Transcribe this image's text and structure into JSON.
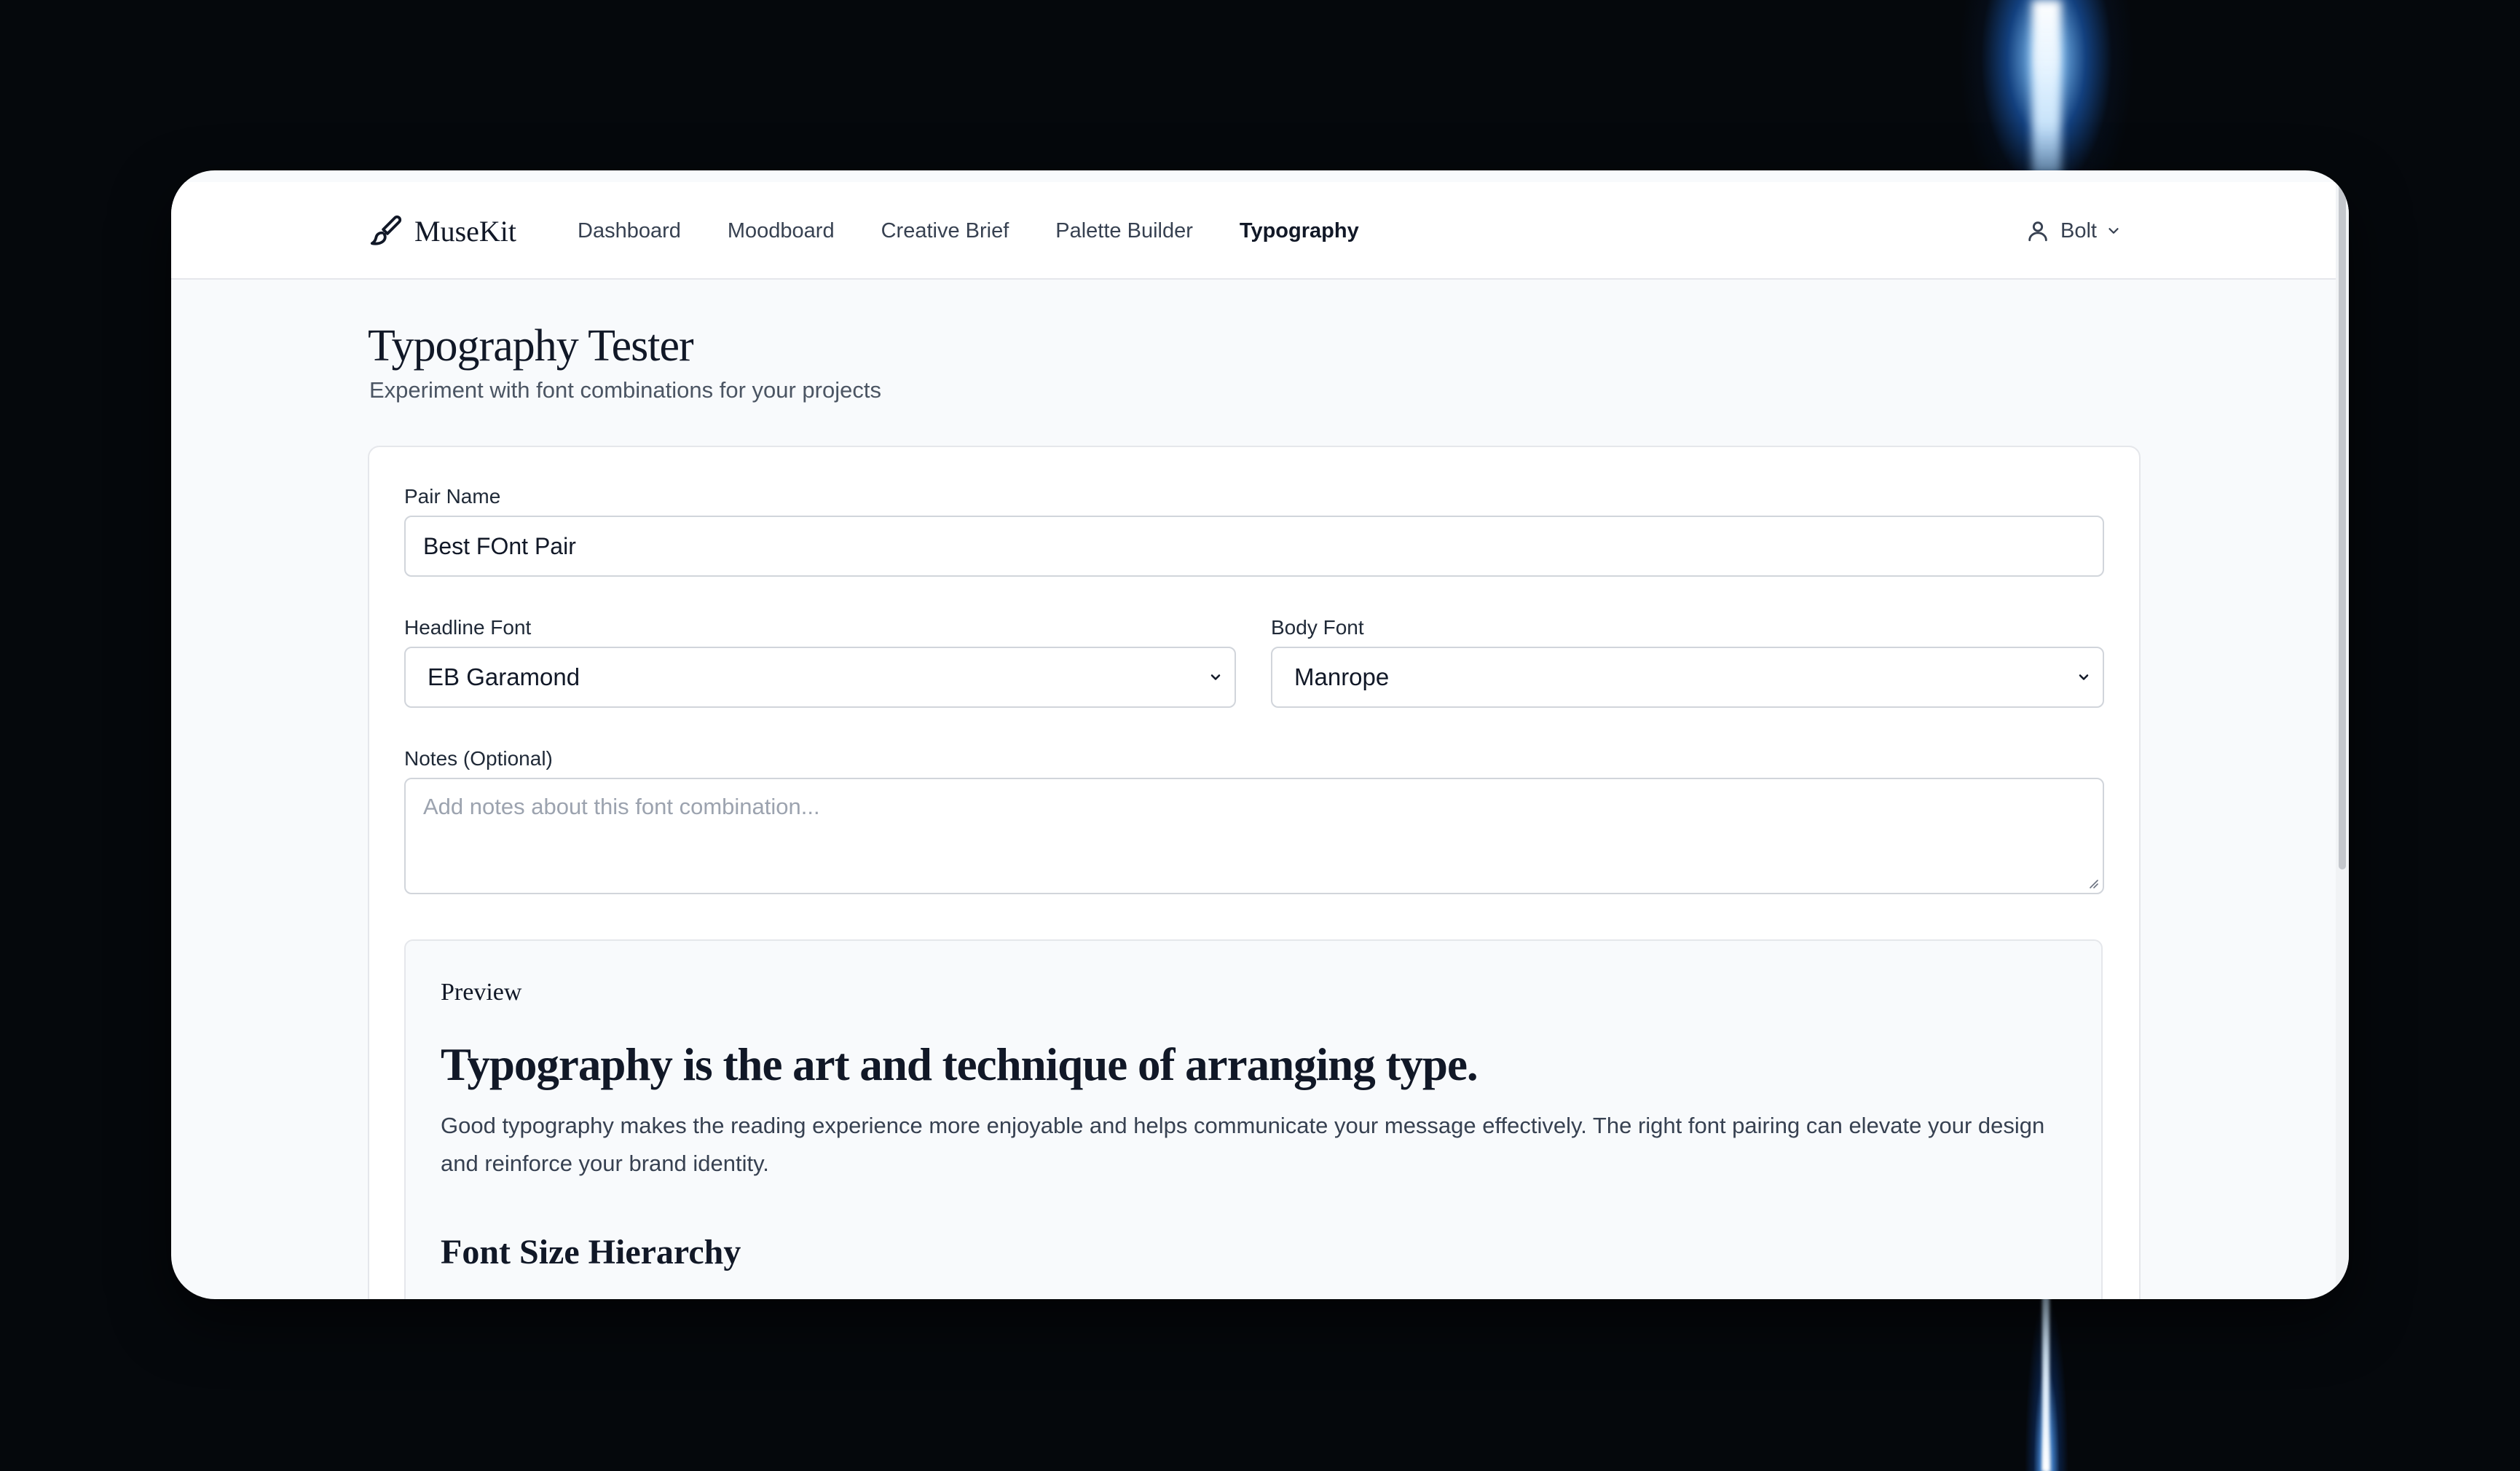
{
  "app": {
    "name": "MuseKit",
    "logo_icon": "paintbrush-icon"
  },
  "nav": {
    "items": [
      {
        "label": "Dashboard",
        "active": false
      },
      {
        "label": "Moodboard",
        "active": false
      },
      {
        "label": "Creative Brief",
        "active": false
      },
      {
        "label": "Palette Builder",
        "active": false
      },
      {
        "label": "Typography",
        "active": true
      }
    ]
  },
  "user": {
    "name": "Bolt",
    "icon": "user-icon"
  },
  "page": {
    "title": "Typography Tester",
    "subtitle": "Experiment with font combinations for your projects"
  },
  "form": {
    "pair_name_label": "Pair Name",
    "pair_name_value": "Best FOnt Pair",
    "headline_font_label": "Headline Font",
    "headline_font_value": "EB Garamond",
    "body_font_label": "Body Font",
    "body_font_value": "Manrope",
    "notes_label": "Notes (Optional)",
    "notes_placeholder": "Add notes about this font combination..."
  },
  "preview": {
    "label": "Preview",
    "headline": "Typography is the art and technique of arranging type.",
    "body": "Good typography makes the reading experience more enjoyable and helps communicate your message effectively. The right font pairing can elevate your design and reinforce your brand identity.",
    "subheading": "Font Size Hierarchy"
  },
  "colors": {
    "accent": "#111827",
    "surface": "#f8fafc",
    "border": "#e5e7eb"
  }
}
